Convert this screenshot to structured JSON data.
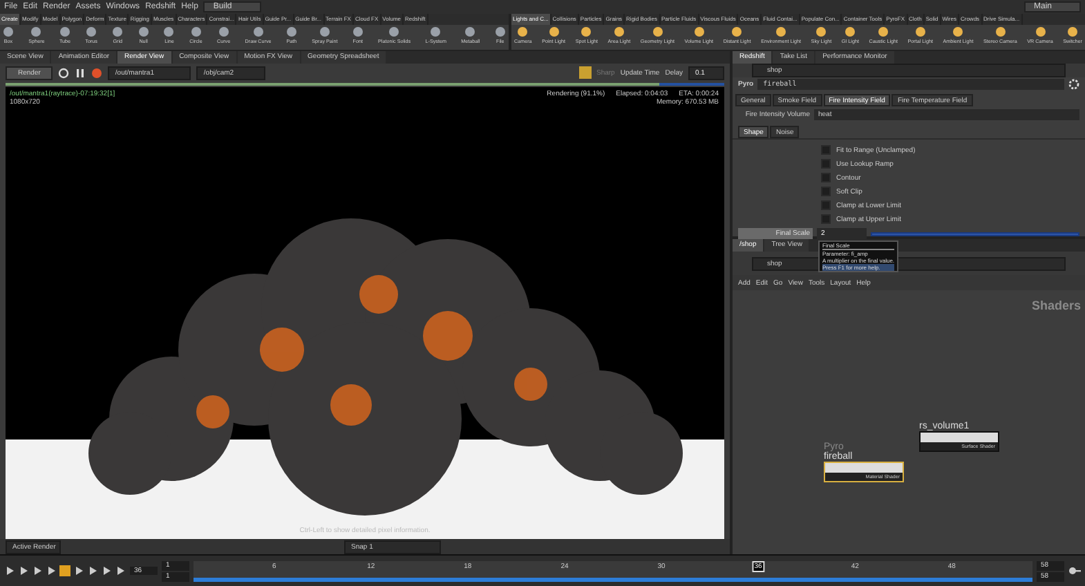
{
  "menu_bar": {
    "items": [
      "File",
      "Edit",
      "Render",
      "Assets",
      "Windows",
      "Redshift",
      "Help"
    ],
    "desktop": "Build",
    "shelf_set": "Main"
  },
  "shelf_left": {
    "tabs": [
      {
        "label": "Create",
        "selected": true
      },
      {
        "label": "Modify",
        "selected": false
      },
      {
        "label": "Model",
        "selected": false
      },
      {
        "label": "Polygon",
        "selected": false
      },
      {
        "label": "Deform",
        "selected": false
      },
      {
        "label": "Texture",
        "selected": false
      },
      {
        "label": "Rigging",
        "selected": false
      },
      {
        "label": "Muscles",
        "selected": false
      },
      {
        "label": "Characters",
        "selected": false
      },
      {
        "label": "Constrai...",
        "selected": false
      },
      {
        "label": "Hair Utils",
        "selected": false
      },
      {
        "label": "Guide Pr...",
        "selected": false
      },
      {
        "label": "Guide Br...",
        "selected": false
      },
      {
        "label": "Terrain FX",
        "selected": false
      },
      {
        "label": "Cloud FX",
        "selected": false
      },
      {
        "label": "Volume",
        "selected": false
      },
      {
        "label": "Redshift",
        "selected": false
      }
    ],
    "tools": [
      "Box",
      "Sphere",
      "Tube",
      "Torus",
      "Grid",
      "Null",
      "Line",
      "Circle",
      "Curve",
      "Draw Curve",
      "Path",
      "Spray Paint",
      "Font",
      "Platonic Solids",
      "L-System",
      "Metaball",
      "File"
    ]
  },
  "shelf_right": {
    "tabs": [
      {
        "label": "Lights and C...",
        "selected": true
      },
      {
        "label": "Collisions",
        "selected": false
      },
      {
        "label": "Particles",
        "selected": false
      },
      {
        "label": "Grains",
        "selected": false
      },
      {
        "label": "Rigid Bodies",
        "selected": false
      },
      {
        "label": "Particle Fluids",
        "selected": false
      },
      {
        "label": "Viscous Fluids",
        "selected": false
      },
      {
        "label": "Oceans",
        "selected": false
      },
      {
        "label": "Fluid Contai...",
        "selected": false
      },
      {
        "label": "Populate Con...",
        "selected": false
      },
      {
        "label": "Container Tools",
        "selected": false
      },
      {
        "label": "PyroFX",
        "selected": false
      },
      {
        "label": "Cloth",
        "selected": false
      },
      {
        "label": "Solid",
        "selected": false
      },
      {
        "label": "Wires",
        "selected": false
      },
      {
        "label": "Crowds",
        "selected": false
      },
      {
        "label": "Drive Simula...",
        "selected": false
      }
    ],
    "tools": [
      "Camera",
      "Point Light",
      "Spot Light",
      "Area Light",
      "Geometry Light",
      "Volume Light",
      "Distant Light",
      "Environment Light",
      "Sky Light",
      "GI Light",
      "Caustic Light",
      "Portal Light",
      "Ambient Light",
      "Stereo Camera",
      "VR Camera",
      "Switcher"
    ]
  },
  "render_pane": {
    "tabs": [
      {
        "label": "Scene View",
        "selected": false
      },
      {
        "label": "Animation Editor",
        "selected": false
      },
      {
        "label": "Render View",
        "selected": true
      },
      {
        "label": "Composite View",
        "selected": false
      },
      {
        "label": "Motion FX View",
        "selected": false
      },
      {
        "label": "Geometry Spreadsheet",
        "selected": false
      }
    ],
    "render_button": "Render",
    "output": "/out/mantra1",
    "camera": "/obj/cam2",
    "preview": "Sharp",
    "update_time": "Update Time",
    "delay_label": "Delay",
    "delay": "0.1",
    "progress": {
      "level": 0.91
    },
    "info_left": [
      "/out/mantra1(raytrace)-07:19:32[1]",
      "1080x720"
    ],
    "status": "Rendering (91.1%)",
    "elapsed": "Elapsed: 0:04:03",
    "eta": "ETA: 0:00:24",
    "memory": "Memory:   670.53 MB",
    "hint": "Ctrl-Left to show detailed pixel information.",
    "footer_label": "Active Render",
    "snap": "Snap  1"
  },
  "parameter_pane": {
    "tabs": [
      {
        "label": "Redshift",
        "selected": true
      },
      {
        "label": "Take List",
        "selected": false
      },
      {
        "label": "Performance Monitor",
        "selected": false
      }
    ],
    "path": "shop",
    "node_type": "Pyro",
    "node_name": "fireball",
    "folders": [
      {
        "label": "General",
        "selected": false
      },
      {
        "label": "Smoke Field",
        "selected": false
      },
      {
        "label": "Fire Intensity Field",
        "selected": true
      },
      {
        "label": "Fire Temperature Field",
        "selected": false
      }
    ],
    "volume_label": "Fire Intensity Volume",
    "volume_value": "heat",
    "sub_folders": [
      {
        "label": "Shape",
        "selected": true
      },
      {
        "label": "Noise",
        "selected": false
      }
    ],
    "toggles": [
      {
        "label": "Fit to Range (Unclamped)",
        "checked": false
      },
      {
        "label": "Use Lookup Ramp",
        "checked": false
      },
      {
        "label": "Contour",
        "checked": false
      },
      {
        "label": "Soft Clip",
        "checked": false
      },
      {
        "label": "Clamp at Lower Limit",
        "checked": false
      },
      {
        "label": "Clamp at Upper Limit",
        "checked": false
      }
    ],
    "final_scale_label": "Final Scale",
    "final_scale_value": "2",
    "tooltip": {
      "title": "Final Scale",
      "parameter": "Parameter: fi_amp",
      "description": "A multiplier on the final value.",
      "help": "Press F1 for more help."
    }
  },
  "network_pane": {
    "tabs": [
      {
        "label": "/shop",
        "selected": true
      },
      {
        "label": "Tree View",
        "selected": false
      }
    ],
    "path": "shop",
    "menu": [
      "Add",
      "Edit",
      "Go",
      "View",
      "Tools",
      "Layout",
      "Help"
    ],
    "context_label": "Shaders",
    "nodes": [
      {
        "name": "rs_volume1",
        "output": "Surface Shader",
        "selected": false
      },
      {
        "type_label": "Pyro",
        "name": "fireball",
        "output": "Material Shader",
        "selected": true
      }
    ]
  },
  "timeline": {
    "start": "1",
    "range_start": "1",
    "current": "36",
    "end": "58",
    "range_end": "58",
    "ticks": [
      "6",
      "12",
      "18",
      "24",
      "30",
      "42",
      "48"
    ],
    "playhead": {
      "level": 0.673,
      "label": "36"
    }
  }
}
